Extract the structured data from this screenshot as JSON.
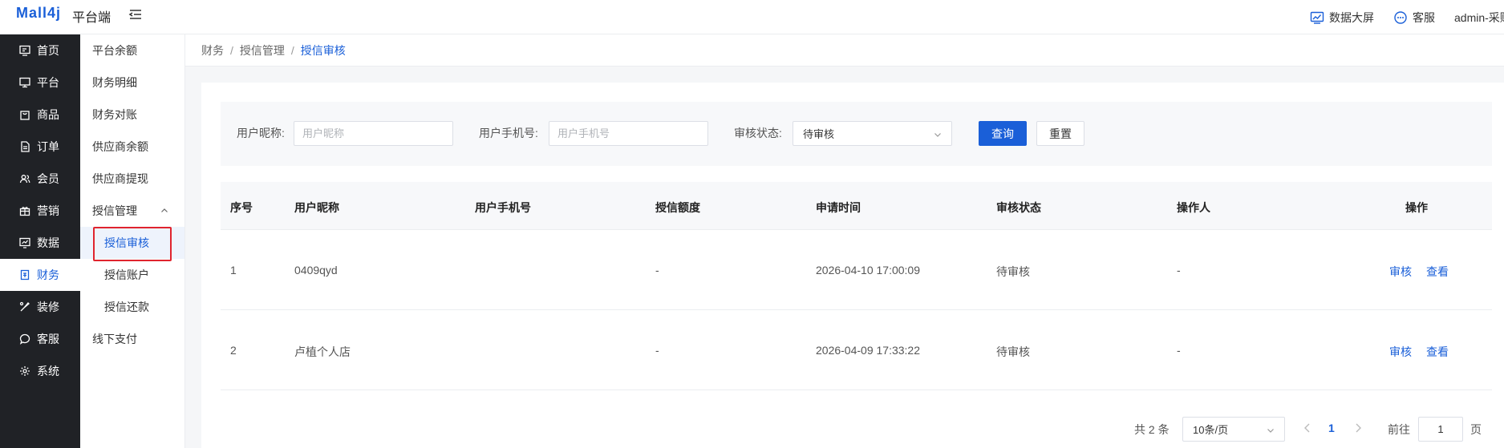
{
  "header": {
    "logo": "Mall4j",
    "logo_sub": "平台端",
    "links": [
      {
        "label": "数据大屏",
        "icon": "chart-screen-icon"
      },
      {
        "label": "客服",
        "icon": "chat-bubble-icon"
      }
    ],
    "user": "admin-采购"
  },
  "main_nav": [
    {
      "label": "首页",
      "icon": "monitor-icon"
    },
    {
      "label": "平台",
      "icon": "desktop-icon"
    },
    {
      "label": "商品",
      "icon": "bag-icon"
    },
    {
      "label": "订单",
      "icon": "document-icon"
    },
    {
      "label": "会员",
      "icon": "user-group-icon"
    },
    {
      "label": "营销",
      "icon": "gift-icon"
    },
    {
      "label": "数据",
      "icon": "chart-icon"
    },
    {
      "label": "财务",
      "icon": "wallet-icon",
      "active": true
    },
    {
      "label": "装修",
      "icon": "brush-icon"
    },
    {
      "label": "客服",
      "icon": "message-icon"
    },
    {
      "label": "系统",
      "icon": "gear-icon"
    }
  ],
  "sub_nav": [
    {
      "label": "平台余额"
    },
    {
      "label": "财务明细"
    },
    {
      "label": "财务对账"
    },
    {
      "label": "供应商余额"
    },
    {
      "label": "供应商提现"
    },
    {
      "label": "授信管理",
      "expanded": true
    },
    {
      "label": "授信审核",
      "active": true
    },
    {
      "label": "授信账户"
    },
    {
      "label": "授信还款"
    },
    {
      "label": "线下支付"
    }
  ],
  "breadcrumb": [
    "财务",
    "授信管理",
    "授信审核"
  ],
  "search": {
    "nickname_label": "用户昵称:",
    "nickname_placeholder": "用户昵称",
    "phone_label": "用户手机号:",
    "phone_placeholder": "用户手机号",
    "status_label": "审核状态:",
    "status_value": "待审核",
    "query_button": "查询",
    "reset_button": "重置"
  },
  "table": {
    "columns": [
      "序号",
      "用户昵称",
      "用户手机号",
      "授信额度",
      "申请时间",
      "审核状态",
      "操作人",
      "操作"
    ],
    "rows": [
      {
        "index": "1",
        "nickname": "0409qyd",
        "phone": "",
        "credit": "-",
        "time": "2026-04-10 17:00:09",
        "status": "待审核",
        "operator": "-",
        "actions": [
          "审核",
          "查看"
        ]
      },
      {
        "index": "2",
        "nickname": "卢植个人店",
        "phone": "",
        "credit": "-",
        "time": "2026-04-09 17:33:22",
        "status": "待审核",
        "operator": "-",
        "actions": [
          "审核",
          "查看"
        ]
      }
    ]
  },
  "pagination": {
    "total": "共 2 条",
    "page_size": "10条/页",
    "current_page": "1",
    "goto_label": "前往",
    "goto_value": "1",
    "page_suffix": "页"
  },
  "colors": {
    "primary": "#1a5fd8",
    "sidebar_bg": "#202226",
    "highlight_border": "#e0242e"
  }
}
